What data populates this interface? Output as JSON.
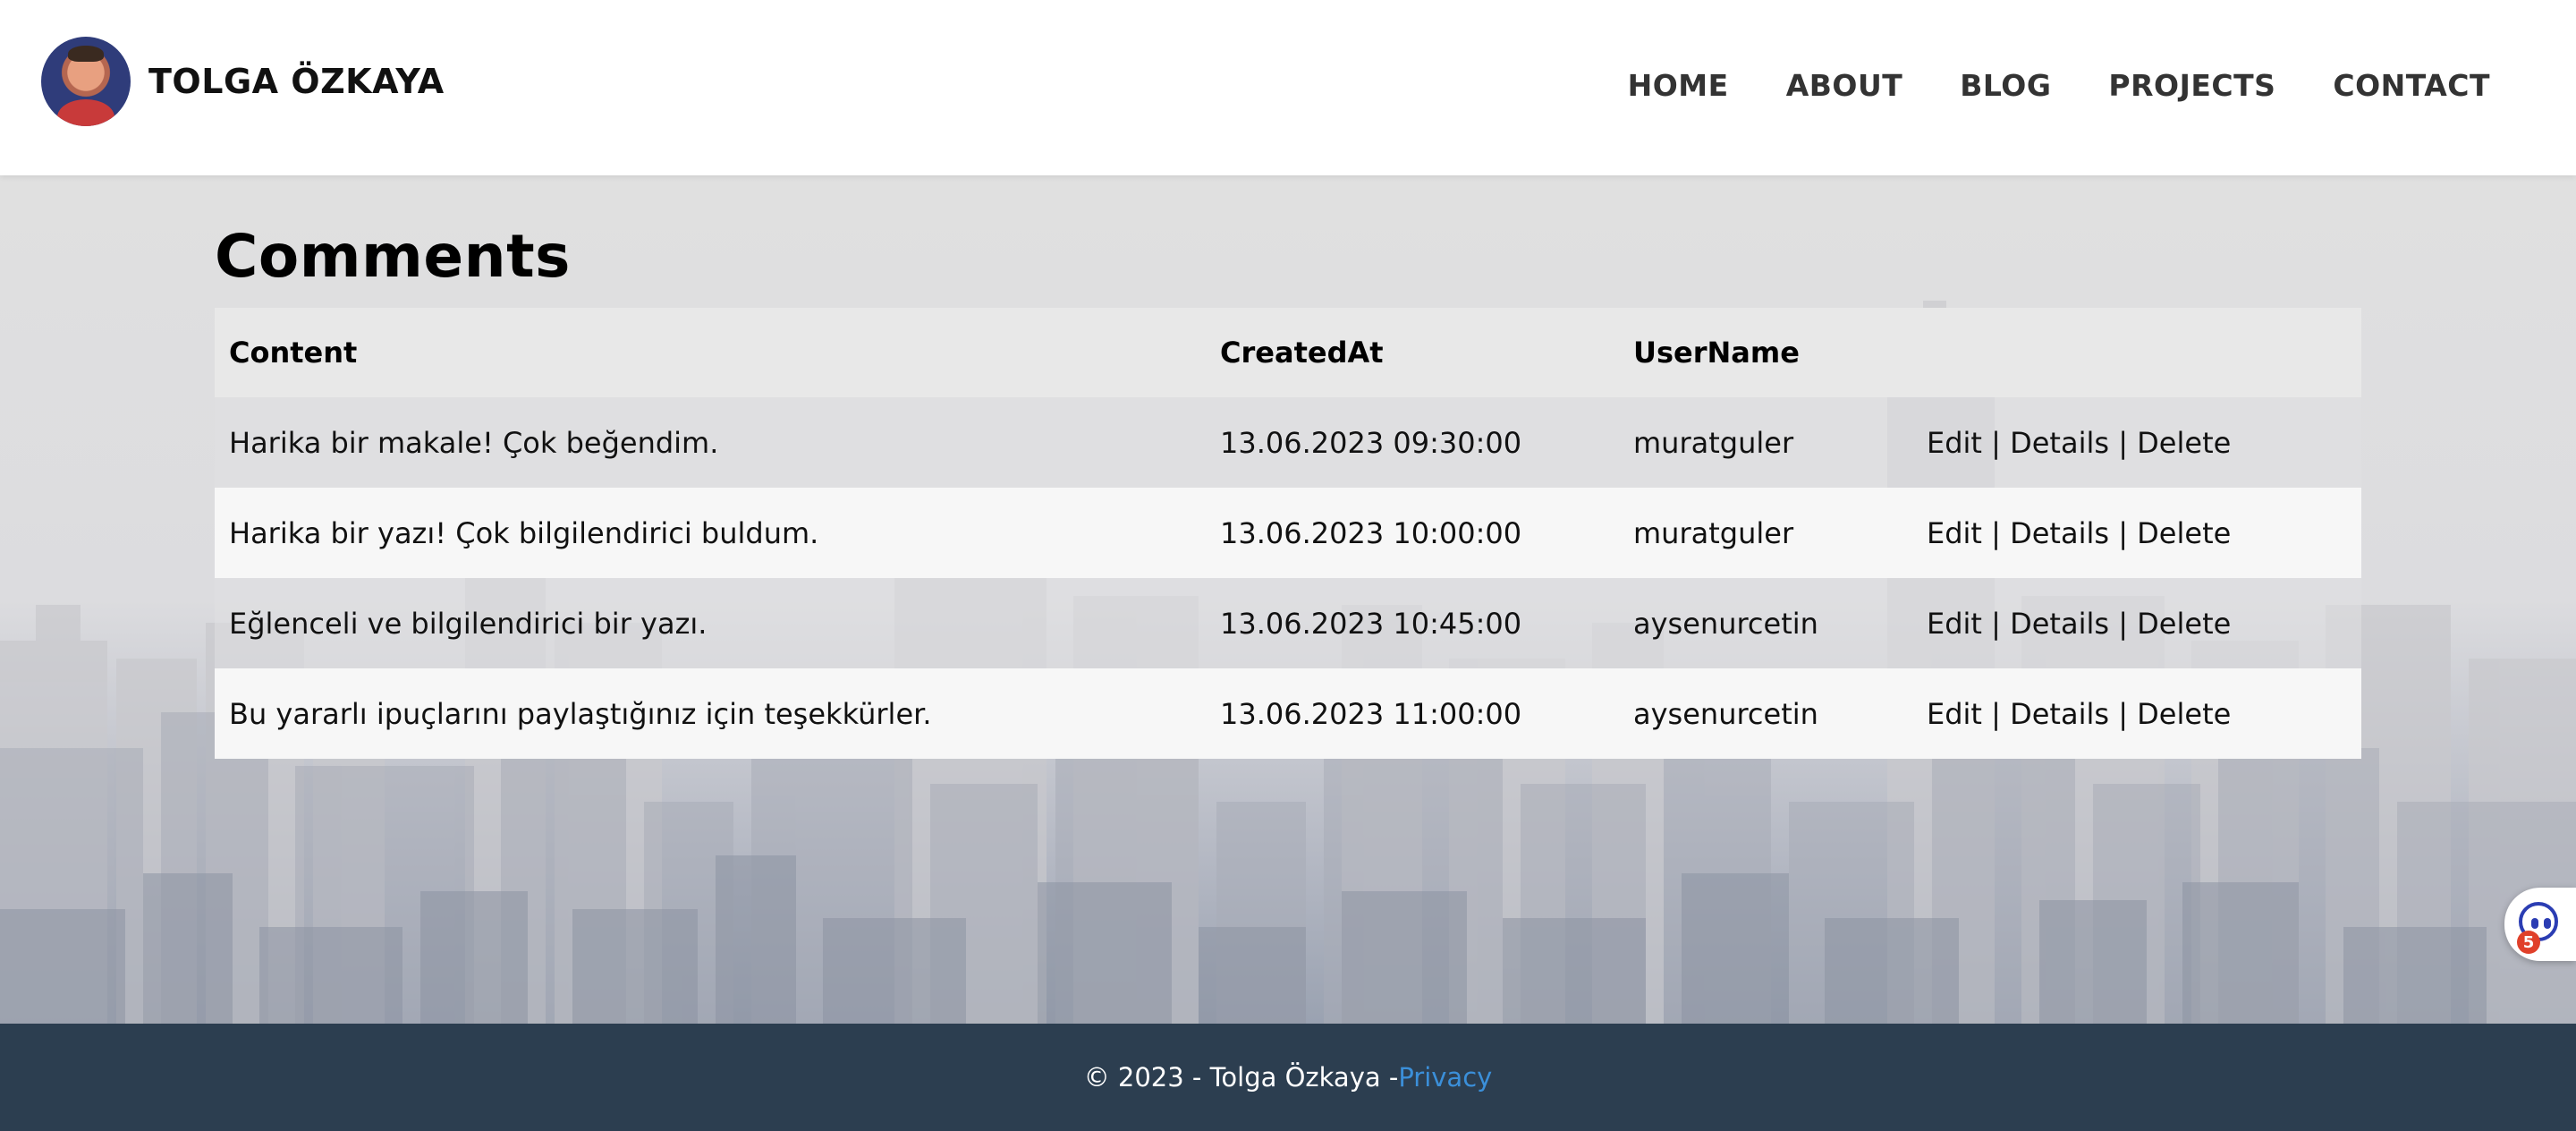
{
  "header": {
    "brand_name": "TOLGA ÖZKAYA",
    "nav": [
      "HOME",
      "ABOUT",
      "BLOG",
      "PROJECTS",
      "CONTACT"
    ]
  },
  "main": {
    "title": "Comments",
    "columns": [
      "Content",
      "CreatedAt",
      "UserName"
    ],
    "rows": [
      {
        "content": "Harika bir makale! Çok beğendim.",
        "created_at": "13.06.2023 09:30:00",
        "username": "muratguler"
      },
      {
        "content": "Harika bir yazı! Çok bilgilendirici buldum.",
        "created_at": "13.06.2023 10:00:00",
        "username": "muratguler"
      },
      {
        "content": "Eğlenceli ve bilgilendirici bir yazı.",
        "created_at": "13.06.2023 10:45:00",
        "username": "aysenurcetin"
      },
      {
        "content": "Bu yararlı ipuçlarını paylaştığınız için teşekkürler.",
        "created_at": "13.06.2023 11:00:00",
        "username": "aysenurcetin"
      }
    ],
    "actions": {
      "edit": "Edit",
      "details": "Details",
      "delete": "Delete",
      "separator": "|"
    }
  },
  "footer": {
    "copyright": "© 2023 - Tolga Özkaya - ",
    "privacy": "Privacy"
  },
  "widget": {
    "icon": "assistant-face-icon",
    "badge": "5"
  },
  "colors": {
    "footer_bg": "#2c3e50",
    "link": "#3b8fd9",
    "header_bg": "#ffffff"
  }
}
